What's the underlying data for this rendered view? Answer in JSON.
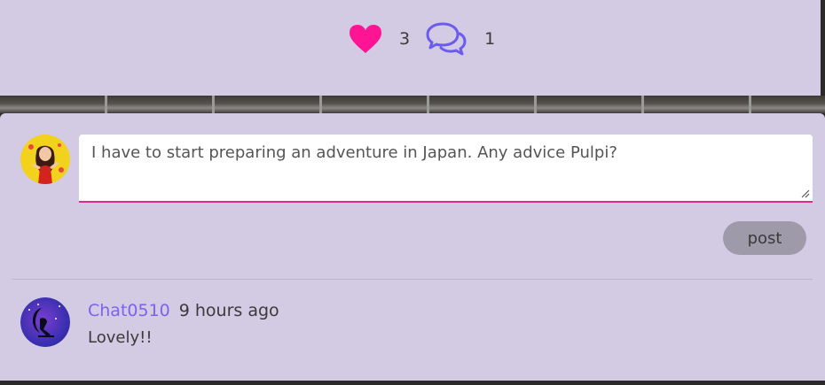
{
  "post_reactions": {
    "like_count": "3",
    "comment_count": "1",
    "heart_color": "#ff1493",
    "chat_icon_color": "#6b5bf0"
  },
  "comment_form": {
    "input_value": "I have to start preparing an adventure in Japan. Any advice Pulpi?",
    "post_label": "post",
    "accent_color": "#e0288f"
  },
  "comments": [
    {
      "username": "Chat0510",
      "time_ago": "9 hours ago",
      "text": "Lovely!!",
      "username_color": "#7b63f0"
    }
  ],
  "icons": {
    "like": "heart-icon",
    "comments": "chat-bubbles-icon",
    "resize": "resize-grip-icon"
  }
}
